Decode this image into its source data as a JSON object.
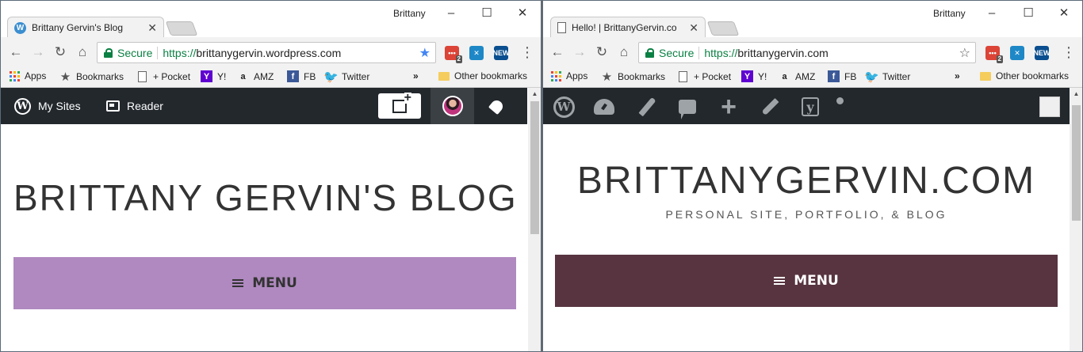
{
  "left": {
    "profile_name": "Brittany",
    "tab_title": "Brittany Gervin's Blog",
    "omnibox": {
      "secure_label": "Secure",
      "url_scheme": "https://",
      "url_host": "brittanygervin.wordpress.com"
    },
    "extensions": [
      {
        "name": "todoist-extension",
        "badge": "2"
      },
      {
        "name": "pocket-extension"
      },
      {
        "name": "news-extension",
        "label": "NEW"
      }
    ],
    "bookmarks": [
      "Apps",
      "Bookmarks",
      "+ Pocket",
      "Y!",
      "AMZ",
      "FB",
      "Twitter"
    ],
    "bookmarks_overflow": "»",
    "other_bookmarks": "Other bookmarks",
    "masterbar": {
      "my_sites": "My Sites",
      "reader": "Reader"
    },
    "site": {
      "title": "BRITTANY GERVIN'S BLOG",
      "menu_label": "MENU",
      "menu_color": "#af89bf",
      "menu_text_color": "#333333"
    }
  },
  "right": {
    "profile_name": "Brittany",
    "tab_title": "Hello! | BrittanyGervin.co",
    "omnibox": {
      "secure_label": "Secure",
      "url_scheme": "https://",
      "url_host": "brittanygervin.com"
    },
    "extensions": [
      {
        "name": "todoist-extension",
        "badge": "2"
      },
      {
        "name": "pocket-extension"
      },
      {
        "name": "news-extension",
        "label": "NEW"
      }
    ],
    "bookmarks": [
      "Apps",
      "Bookmarks",
      "+ Pocket",
      "Y!",
      "AMZ",
      "FB",
      "Twitter"
    ],
    "bookmarks_overflow": "»",
    "other_bookmarks": "Other bookmarks",
    "site": {
      "title": "BRITTANYGERVIN.COM",
      "tagline": "PERSONAL SITE, PORTFOLIO, & BLOG",
      "menu_label": "MENU",
      "menu_color": "#57343f",
      "menu_text_color": "#ffffff"
    }
  },
  "colors": {
    "admin_bar": "#23282d",
    "secure_green": "#0b8043",
    "star_blue": "#4285f4"
  }
}
